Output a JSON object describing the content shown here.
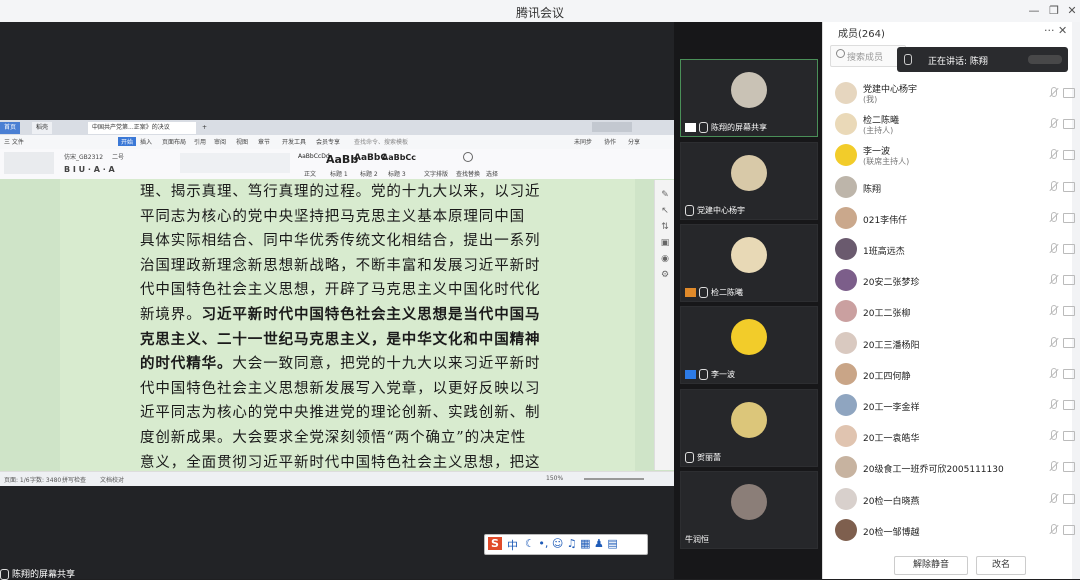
{
  "window": {
    "title": "腾讯会议"
  },
  "wps": {
    "tabs": [
      "首页",
      "稻壳",
      "中国共产党第...正案》的决议"
    ],
    "menu": [
      "三 文件",
      "开始",
      "插入",
      "页面布局",
      "引用",
      "审阅",
      "视图",
      "章节",
      "开发工具",
      "会员专享",
      "查找命令、搜索模板"
    ],
    "toolbar": {
      "font_name": "仿宋_GB2312",
      "font_size": "二号",
      "styles": [
        "AaBbCcDd",
        "AaBb",
        "AaBbC",
        "AaBbCc"
      ],
      "style_names": [
        "正文",
        "标题 1",
        "标题 2",
        "标题 3"
      ],
      "tools": [
        "文字排版",
        "查找替换",
        "选择"
      ],
      "right": [
        "未同步",
        "协作",
        "分享"
      ]
    },
    "status": {
      "page": "页面: 1/6",
      "words": "字数: 3480",
      "spell": "拼写检查",
      "doc_check": "文档校对",
      "zoom": "150%"
    }
  },
  "document": {
    "lines": [
      {
        "text": "理、揭示真理、笃行真理的过程。党的十九大以来，以习近"
      },
      {
        "text": "平同志为核心的党中央坚持把马克思主义基本原理同中国"
      },
      {
        "text": "具体实际相结合、同中华优秀传统文化相结合，提出一系列"
      },
      {
        "text": "治国理政新理念新思想新战略，不断丰富和发展习近平新时"
      },
      {
        "text": "代中国特色社会主义思想，开辟了马克思主义中国化时代化"
      },
      {
        "text": "新境界。",
        "bold": "习近平新时代中国特色社会主义思想是当代中国马"
      },
      {
        "text": "",
        "bold": "克思主义、二十一世纪马克思主义，是中华文化和中国精神"
      },
      {
        "text": "大会一致同意，把党的十九大以来习近平新时",
        "bold": "的时代精华。"
      },
      {
        "text": "代中国特色社会主义思想新发展写入党章，以更好反映以习"
      },
      {
        "text": "近平同志为核心的党中央推进党的理论创新、实践创新、制"
      },
      {
        "text": "度创新成果。大会要求全党深刻领悟“两个确立”的决定性"
      },
      {
        "text": "意义，全面贯彻习近平新时代中国特色社会主义思想，把这"
      }
    ]
  },
  "ime": {
    "logo": "S",
    "mode": "中"
  },
  "share_label": "陈翔的屏幕共享",
  "videos": [
    {
      "label": "陈翔的屏幕共享",
      "color": "#c9c2b5",
      "active": true,
      "icon": "screen"
    },
    {
      "label": "党建中心杨宇",
      "color": "#d8c9a8",
      "active": false,
      "icon": "none"
    },
    {
      "label": "检二陈曦",
      "color": "#e8d9b6",
      "active": false,
      "icon": "user"
    },
    {
      "label": "李一波",
      "color": "#f2cc2a",
      "active": false,
      "icon": "user"
    },
    {
      "label": "贺丽蕾",
      "color": "#dcc67a",
      "active": false,
      "icon": "none"
    },
    {
      "label": "牛润恒",
      "color": "#8b7e78",
      "active": false,
      "icon": "none"
    }
  ],
  "panel": {
    "title": "成员(264)",
    "search_placeholder": "搜索成员",
    "speaking": "正在讲话: 陈翔",
    "unmute_all": "解除静音",
    "rename": "改名"
  },
  "members": [
    {
      "name": "党建中心杨宇",
      "role": "(我)",
      "color": "#e6d6bf"
    },
    {
      "name": "检二陈曦",
      "role": "(主持人)",
      "color": "#ead9b8"
    },
    {
      "name": "李一波",
      "role": "(联席主持人)",
      "color": "#f2cc2a"
    },
    {
      "name": "陈翔",
      "role": "",
      "color": "#bdb5aa"
    },
    {
      "name": "021李伟仟",
      "role": "",
      "color": "#caa88c"
    },
    {
      "name": "1班高远杰",
      "role": "",
      "color": "#6a5a6e"
    },
    {
      "name": "20安二张梦珍",
      "role": "",
      "color": "#7c5e8a"
    },
    {
      "name": "20工二张柳",
      "role": "",
      "color": "#caa0a0"
    },
    {
      "name": "20工三潘杨阳",
      "role": "",
      "color": "#d9c9c0"
    },
    {
      "name": "20工四何静",
      "role": "",
      "color": "#c9a587"
    },
    {
      "name": "20工一李金祥",
      "role": "",
      "color": "#8fa5c0"
    },
    {
      "name": "20工一袁皓华",
      "role": "",
      "color": "#e0c4b0"
    },
    {
      "name": "20级食工一班乔可欣2005111130",
      "role": "",
      "color": "#c7b3a0"
    },
    {
      "name": "20检一白晓燕",
      "role": "",
      "color": "#d8d0cc"
    },
    {
      "name": "20检一邹博越",
      "role": "",
      "color": "#7e5f4e"
    }
  ]
}
